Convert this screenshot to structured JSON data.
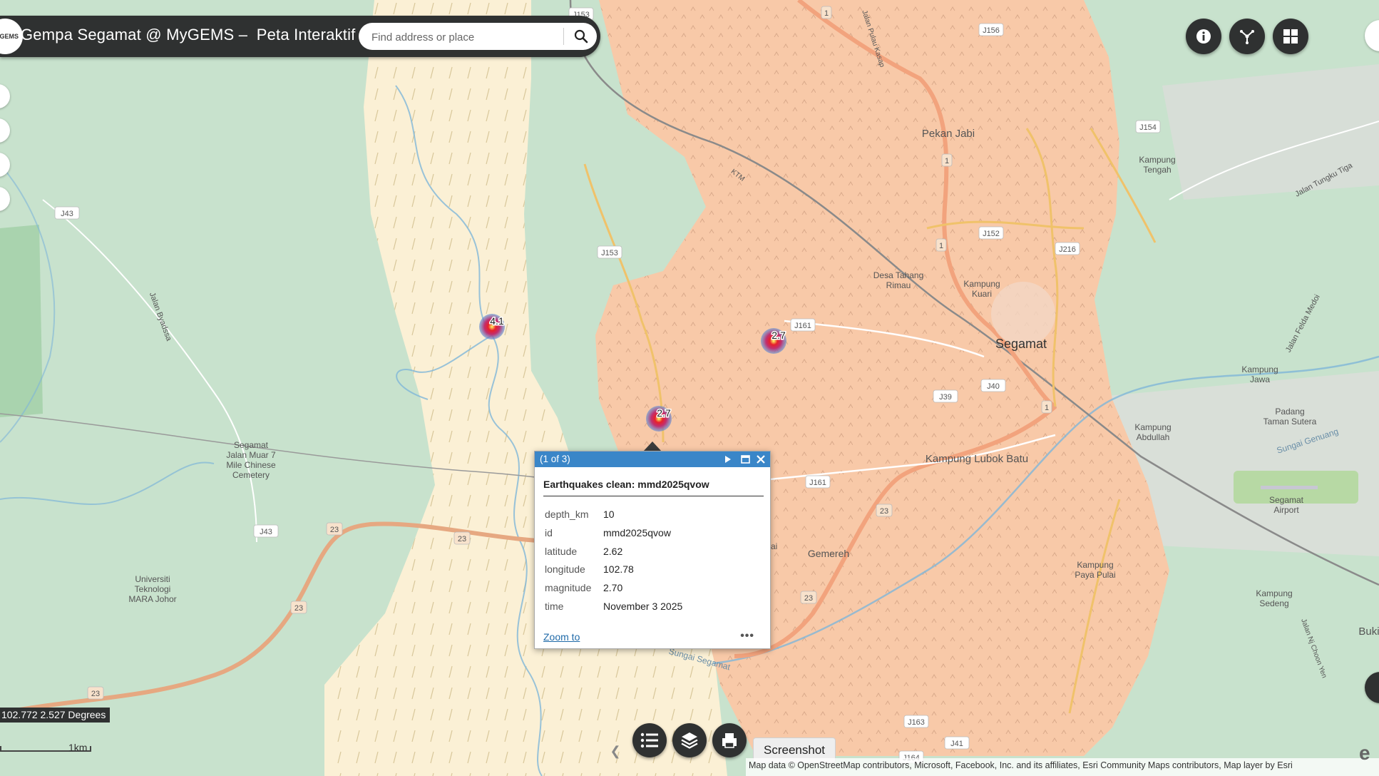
{
  "header": {
    "logo_text": "GEMS",
    "title": "Gempa Segamat @ MyGEMS –  Peta Interaktif"
  },
  "search": {
    "placeholder": "Find address or place"
  },
  "toolbar": {
    "info_icon": "info-icon",
    "basemap_icon": "basemap-icon",
    "grid_icon": "grid-icon"
  },
  "map": {
    "coordinates": "102.772 2.527 Degrees",
    "scale_label": "1km",
    "attribution": "Map data © OpenStreetMap contributors, Microsoft, Facebook, Inc. and its affiliates, Esri Community Maps contributors, Map layer by Esri",
    "markers": [
      {
        "label": "4.1",
        "magnitude": 4.1
      },
      {
        "label": "2.7",
        "magnitude": 2.7
      },
      {
        "label": "2.7",
        "magnitude": 2.7
      }
    ],
    "labels": {
      "segamat": "Segamat",
      "pekan_jabi": "Pekan Jabi",
      "kampung_tengah": "Kampung\nTengah",
      "desa_tahang_rimau": "Desa Tahang\nRimau",
      "kampung_kuari": "Kampung\nKuari",
      "kampung_jawa": "Kampung\nJawa",
      "padang_taman_sutera": "Padang\nTaman Sutera",
      "kampung_abdullah": "Kampung\nAbdullah",
      "kampung_lubok_batu": "Kampung Lubok Batu",
      "segamat_airport": "Segamat\nAirport",
      "kampung_paya_pulai": "Kampung\nPaya Pulai",
      "kampung_sedeng": "Kampung\nSedeng",
      "gemereh": "Gemereh",
      "chinese_cemetery": "Segamat\nJalan Muar 7\nMile Chinese\nCemetery",
      "uitm": "Universiti\nTeknologi\nMARA Johor",
      "jalan_byadssa": "Jalan Byadssa",
      "jalan_tungku_tiga": "Jalan Tungku Tiga",
      "jalan_felda_medoi": "Jalan Felda Medoi",
      "sungai_segamat": "Sungai Segamat",
      "sungai_genuang": "Sungai Genuang",
      "jalan_pulau_kasap": "Jalan Pulau Kasap",
      "jalan_nj_choon_yen": "Jalan Nj Choon Yen",
      "buki": "Buki",
      "ktm": "KTM",
      "ulai": "ulai"
    },
    "road_shields": [
      "J153",
      "J156",
      "J154",
      "J43",
      "J153",
      "J152",
      "J216",
      "J161",
      "J39",
      "J40",
      "J161",
      "J43",
      "J163",
      "J164",
      "J41",
      "23",
      "23",
      "23",
      "23",
      "23",
      "23",
      "1",
      "1",
      "1",
      "1"
    ]
  },
  "popup": {
    "count": "(1 of 3)",
    "title": "Earthquakes clean: mmd2025qvow",
    "fields": [
      {
        "key": "depth_km",
        "value": "10"
      },
      {
        "key": "id",
        "value": "mmd2025qvow"
      },
      {
        "key": "latitude",
        "value": "2.62"
      },
      {
        "key": "longitude",
        "value": "102.78"
      },
      {
        "key": "magnitude",
        "value": "2.70"
      },
      {
        "key": "time",
        "value": "November 3 2025"
      }
    ],
    "zoom_to": "Zoom to",
    "more": "•••"
  },
  "bottom_bar": {
    "legend_icon": "legend-list-icon",
    "layers_icon": "layers-icon",
    "print_icon": "print-icon",
    "tooltip": "Screenshot"
  },
  "colors": {
    "header_bg": "#2f3131",
    "popup_titlebar": "#3a86c8",
    "zone_orange": "#f7c7a6",
    "zone_cream": "#fbefd3",
    "base_green": "#c9e3cf",
    "marker_red": "#d7191c"
  }
}
